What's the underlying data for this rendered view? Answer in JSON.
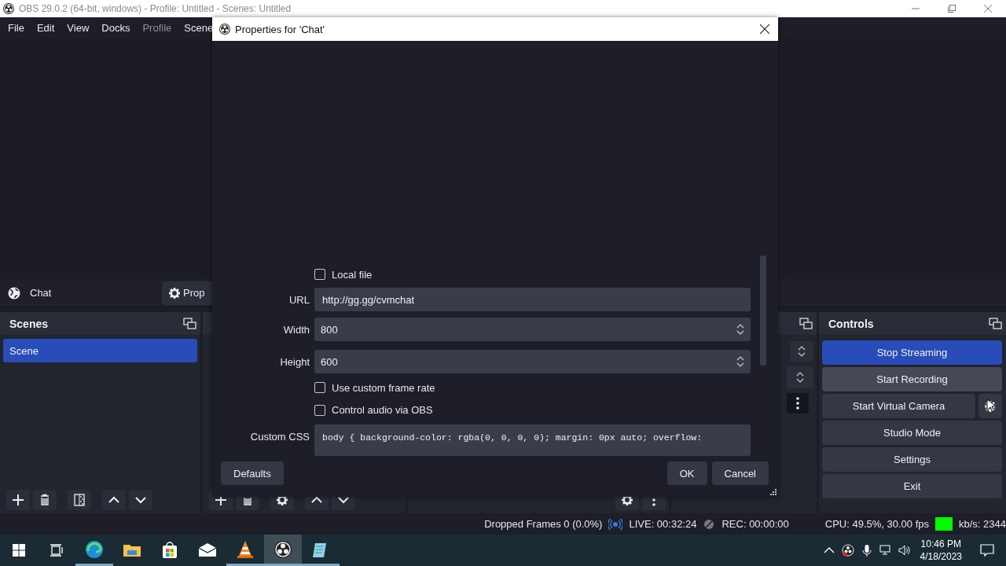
{
  "window": {
    "title": "OBS 29.0.2 (64-bit, windows) - Profile: Untitled - Scenes: Untitled"
  },
  "menu": [
    {
      "label": "File",
      "disabled": false
    },
    {
      "label": "Edit",
      "disabled": false
    },
    {
      "label": "View",
      "disabled": false
    },
    {
      "label": "Docks",
      "disabled": false
    },
    {
      "label": "Profile",
      "disabled": true
    },
    {
      "label": "Scene",
      "disabled": false
    }
  ],
  "source_toolbar": {
    "source": "Chat",
    "properties_button": "Prop"
  },
  "scenes_dock": {
    "title": "Scenes",
    "items": [
      {
        "label": "Scene",
        "selected": true
      }
    ]
  },
  "controls_dock": {
    "title": "Controls",
    "buttons": [
      {
        "label": "Stop Streaming",
        "kind": "toggle",
        "checked": true,
        "hovered": false
      },
      {
        "label": "Start Recording",
        "kind": "toggle",
        "checked": false,
        "hovered": true
      },
      {
        "label": "Start Virtual Camera",
        "kind": "split",
        "checked": false,
        "hovered": false
      },
      {
        "label": "Studio Mode",
        "kind": "toggle",
        "checked": false,
        "hovered": false
      },
      {
        "label": "Settings",
        "kind": "plain",
        "checked": false,
        "hovered": false
      },
      {
        "label": "Exit",
        "kind": "plain",
        "checked": false,
        "hovered": false
      }
    ]
  },
  "dialog": {
    "title": "Properties for 'Chat'",
    "fields": [
      {
        "kind": "checkbox",
        "label": "Local file",
        "checked": false
      },
      {
        "kind": "text",
        "label": "URL",
        "value": "http://gg.gg/cvmchat"
      },
      {
        "kind": "spin",
        "label": "Width",
        "value": "800"
      },
      {
        "kind": "spin",
        "label": "Height",
        "value": "600"
      },
      {
        "kind": "checkbox",
        "label": "Use custom frame rate",
        "checked": false
      },
      {
        "kind": "checkbox",
        "label": "Control audio via OBS",
        "checked": false
      },
      {
        "kind": "textarea",
        "label": "Custom CSS",
        "value": "body { background-color: rgba(0, 0, 0, 0); margin: 0px auto; overflow:"
      }
    ],
    "defaults_button": "Defaults",
    "ok_button": "OK",
    "cancel_button": "Cancel"
  },
  "status_bar": {
    "dropped_frames": "Dropped Frames 0 (0.0%)",
    "live": "LIVE: 00:32:24",
    "rec": "REC: 00:00:00",
    "cpu": "CPU: 49.5%, 30.00 fps",
    "health": {
      "color": "#00ff00"
    },
    "bitrate": "kb/s: 2344"
  },
  "taskbar": {
    "apps": [
      {
        "kind": "edge",
        "running": true,
        "selected": false
      },
      {
        "kind": "folder",
        "running": false,
        "selected": false
      },
      {
        "kind": "store",
        "running": false,
        "selected": false
      },
      {
        "kind": "mail",
        "running": false,
        "selected": false
      },
      {
        "kind": "cone",
        "running": true,
        "selected": false
      },
      {
        "kind": "obs",
        "running": true,
        "selected": true
      },
      {
        "kind": "notepad",
        "running": true,
        "selected": false
      }
    ],
    "time": "10:46 PM",
    "date": "4/18/2023"
  }
}
